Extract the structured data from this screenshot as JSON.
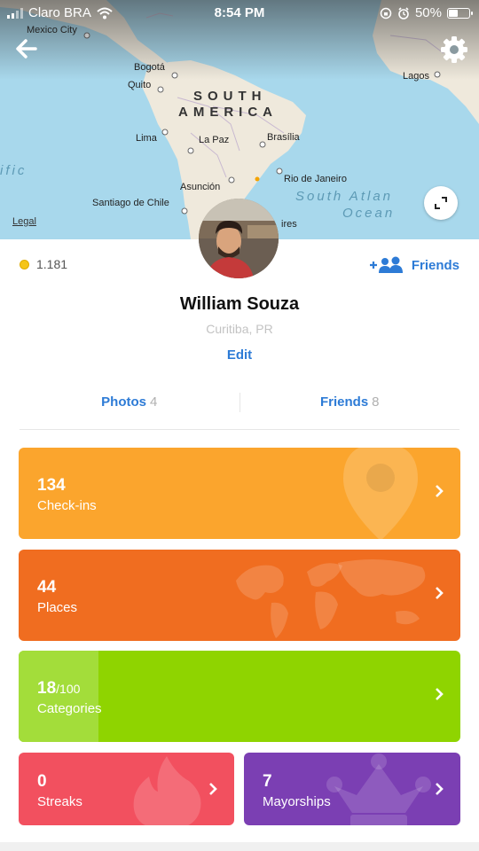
{
  "status_bar": {
    "carrier": "Claro BRA",
    "time": "8:54 PM",
    "battery": "50%",
    "battery_level": 0.5
  },
  "map": {
    "labels": {
      "mexico_city": "Mexico City",
      "bogota": "Bogotá",
      "quito": "Quito",
      "lima": "Lima",
      "la_paz": "La Paz",
      "brasilia": "Brasília",
      "asuncion": "Asunción",
      "santiago": "Santiago de Chile",
      "rio": "Rio de Janeiro",
      "buenos_aires_partial": "ires",
      "lagos": "Lagos",
      "south": "SOUTH",
      "america": "AMERICA",
      "pacific_partial": "ific",
      "south_atlantic": "South Atlan",
      "ocean": "Ocean"
    },
    "legal": "Legal"
  },
  "profile": {
    "coins": "1.181",
    "friends_link": "Friends",
    "name": "William Souza",
    "location": "Curitiba, PR",
    "edit": "Edit"
  },
  "tabs": [
    {
      "label": "Photos",
      "count": "4"
    },
    {
      "label": "Friends",
      "count": "8"
    }
  ],
  "stats": {
    "checkins": {
      "value": "134",
      "label": "Check-ins",
      "color": "#fba52d"
    },
    "places": {
      "value": "44",
      "label": "Places",
      "color": "#f06d20"
    },
    "categories": {
      "value": "18",
      "total": "/100",
      "label": "Categories",
      "color": "#8fd400",
      "light_color": "#a3dd3a",
      "progress": 0.18
    },
    "streaks": {
      "value": "0",
      "label": "Streaks",
      "color": "#f2505f"
    },
    "mayorships": {
      "value": "7",
      "label": "Mayorships",
      "color": "#7b3fb3"
    }
  },
  "icons": [
    "back-arrow-icon",
    "gear-icon",
    "wifi-icon",
    "alarm-icon",
    "battery-icon",
    "expand-icon",
    "coin-icon",
    "add-friends-icon",
    "chevron-right-icon",
    "location-pin-icon",
    "world-map-icon",
    "flame-icon",
    "crown-icon"
  ]
}
